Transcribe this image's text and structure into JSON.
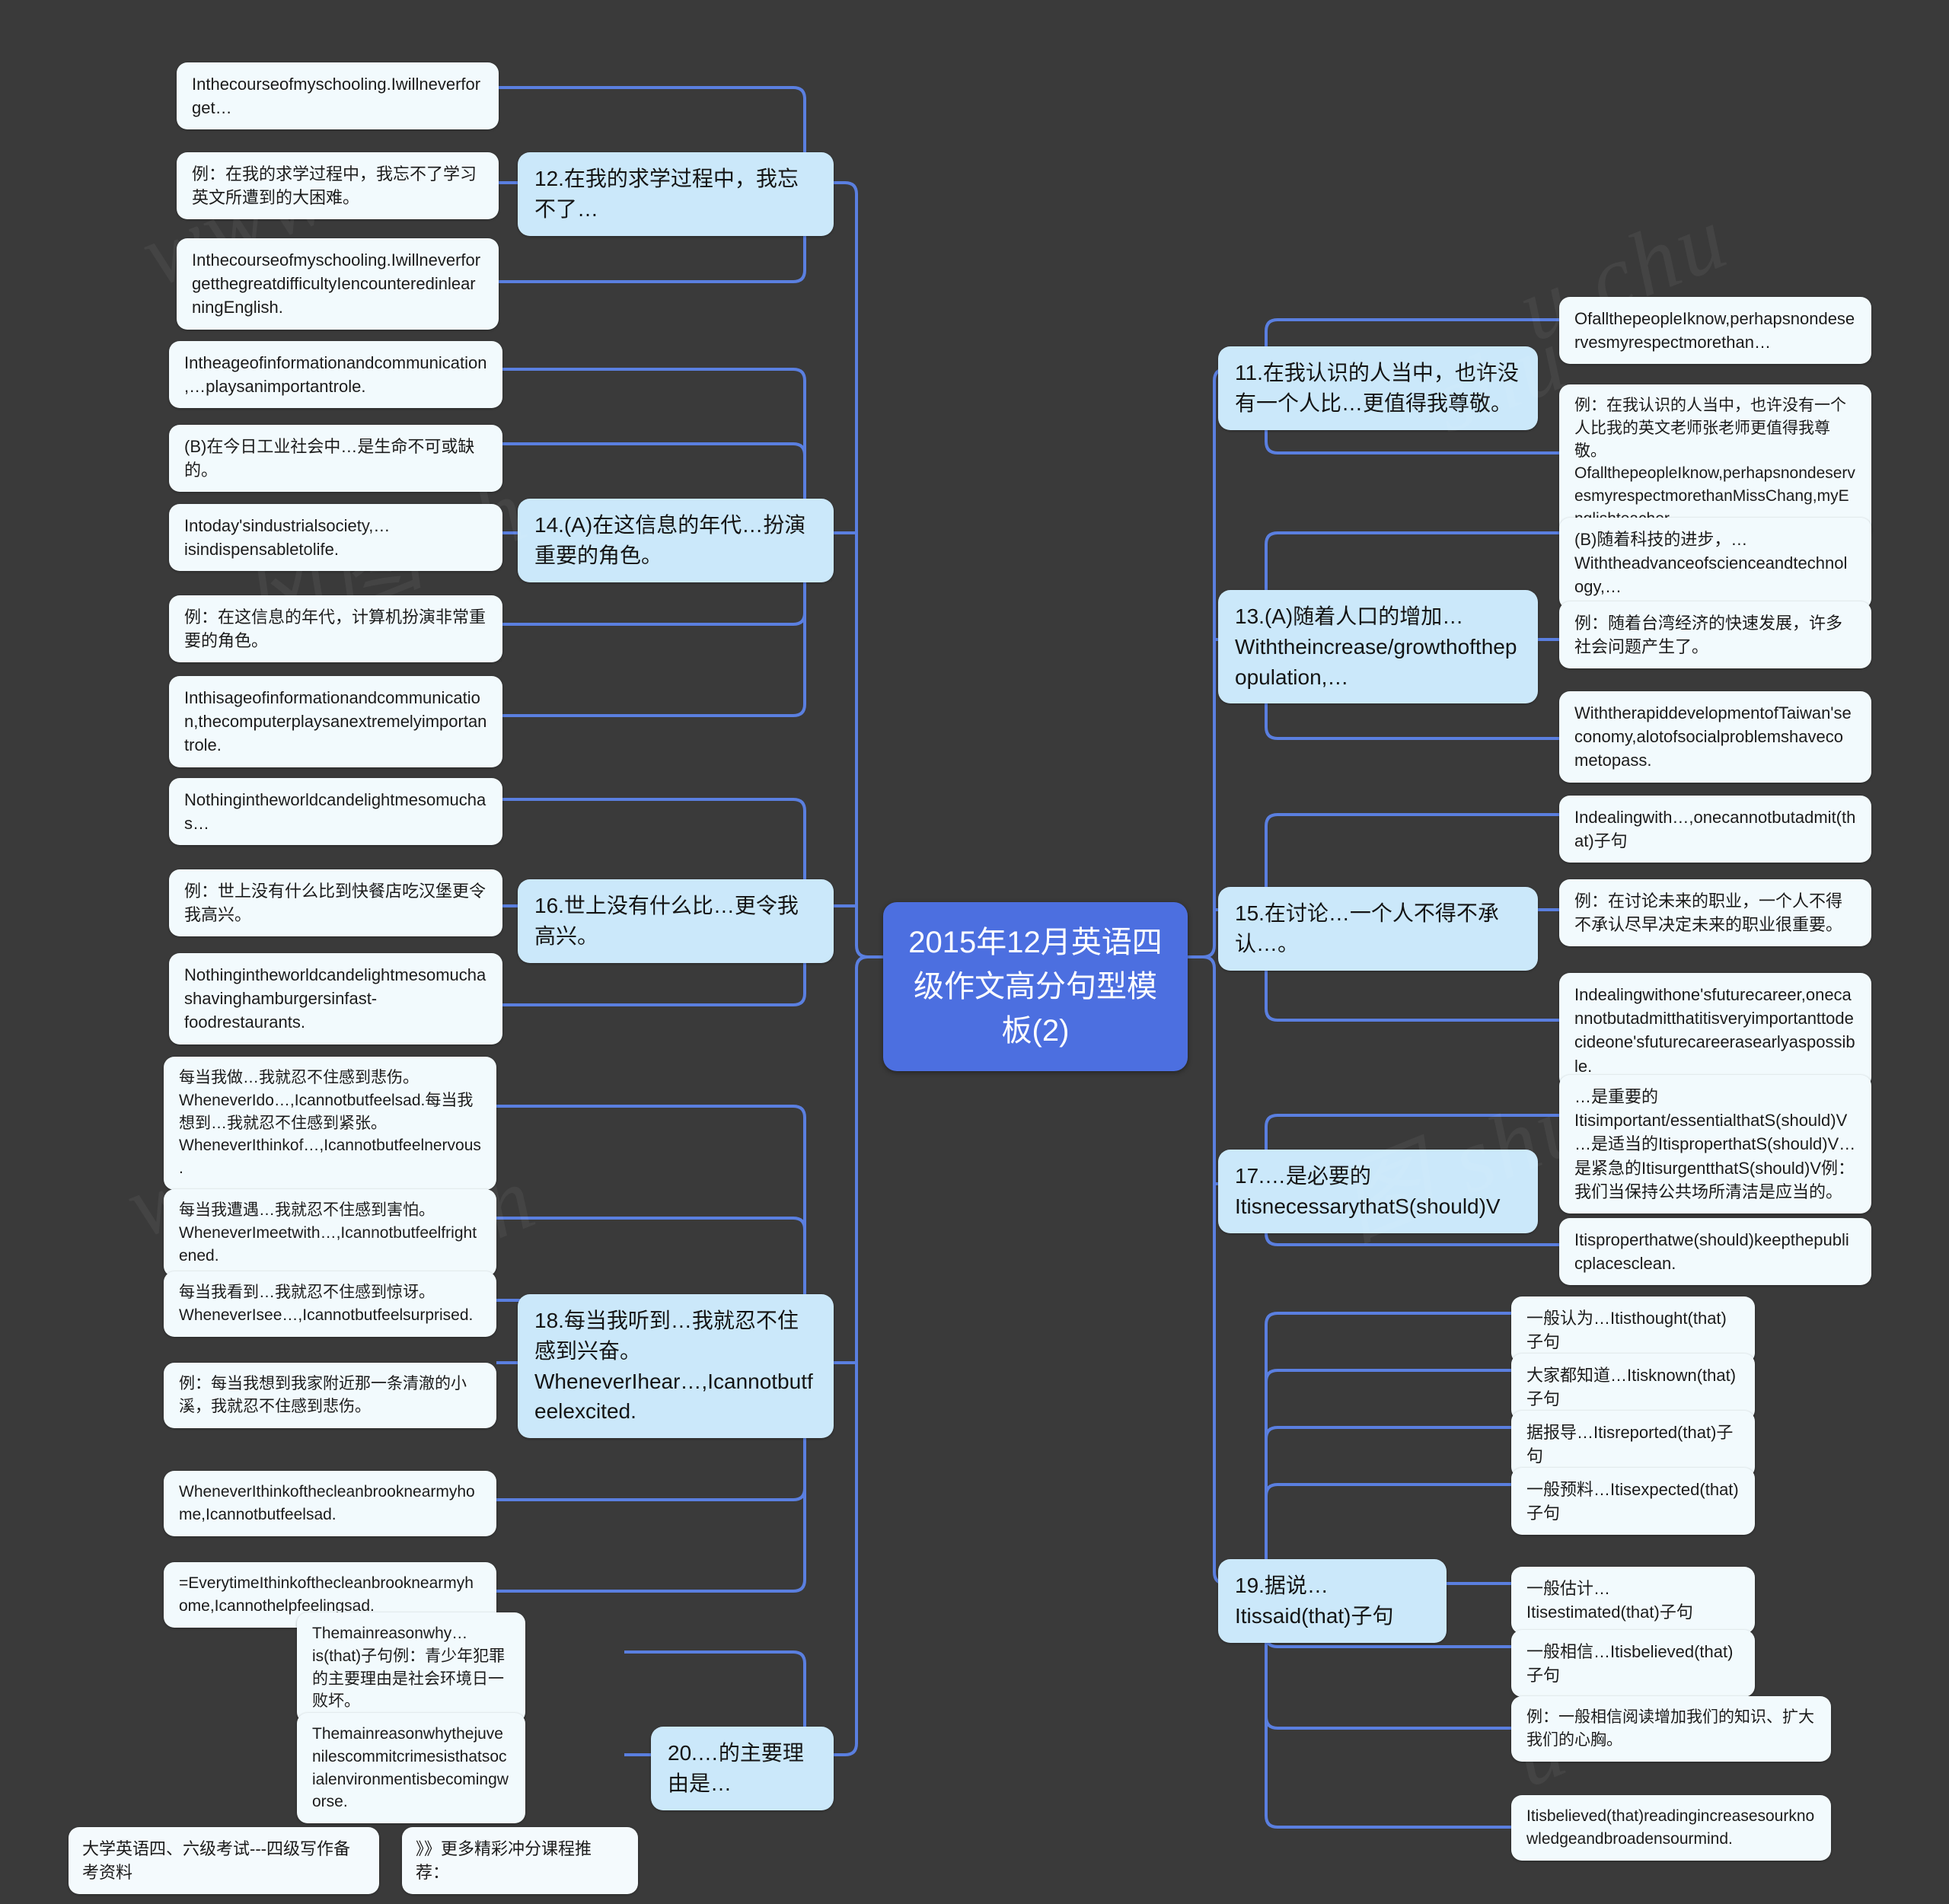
{
  "root": {
    "title": "2015年12月英语四级作文高分句型模板(2)"
  },
  "watermarks": [
    "www.shu...",
    "shu hu",
    "图 shu...",
    "www.s...",
    "风图 sh",
    "chu",
    "A"
  ],
  "colors": {
    "background": "#3a3a3a",
    "root_fill": "#4c6fe0",
    "branch_fill": "#cbe8fa",
    "leaf_fill": "#f2fafd",
    "link_stroke": "#5a7fe0"
  },
  "left_branches": [
    {
      "id": "b12",
      "label": "12.在我的求学过程中，我忘不了…",
      "children": [
        "Inthecourseofmyschooling.Iwillneverforget…",
        "例：在我的求学过程中，我忘不了学习英文所遭到的大困难。",
        "Inthecourseofmyschooling.IwillneverforgetthegreatdifficultyIencounteredinlearningEnglish."
      ]
    },
    {
      "id": "b14",
      "label": "14.(A)在这信息的年代…扮演重要的角色。",
      "children": [
        "Intheageofinformationandcommunication,…playsanimportantrole.",
        "(B)在今日工业社会中…是生命不可或缺的。",
        "Intoday'sindustrialsociety,…isindispensabletolife.",
        "例：在这信息的年代，计算机扮演非常重要的角色。",
        "Inthisageofinformationandcommunication,thecomputerplaysanextremelyimportantrole."
      ]
    },
    {
      "id": "b16",
      "label": "16.世上没有什么比…更令我高兴。",
      "children": [
        "Nothingintheworldcandelightmesomuchas…",
        "例：世上没有什么比到快餐店吃汉堡更令我高兴。",
        "Nothingintheworldcandelightmesomuchashavinghamburgersinfast-foodrestaurants."
      ]
    },
    {
      "id": "b18",
      "label": "18.每当我听到…我就忍不住感到兴奋。WheneverIhear…,Icannotbutfeelexcited.",
      "children": [
        "每当我做…我就忍不住感到悲伤。WheneverIdo…,Icannotbutfeelsad.每当我想到…我就忍不住感到紧张。WheneverIthinkof…,Icannotbutfeelnervous.",
        "每当我遭遇…我就忍不住感到害怕。WheneverImeetwith…,Icannotbutfeelfrightened.",
        "每当我看到…我就忍不住感到惊讶。WheneverIsee…,Icannotbutfeelsurprised.",
        "例：每当我想到我家附近那一条清澈的小溪，我就忍不住感到悲伤。",
        "WheneverIthinkofthecleanbrooknearmyhome,Icannotbutfeelsad.",
        "=EverytimeIthinkofthecleanbrooknearmyhome,Icannothelpfeelingsad."
      ]
    },
    {
      "id": "b20",
      "label": "20.…的主要理由是…",
      "children": [
        "Themainreasonwhy…is(that)子句例：青少年犯罪的主要理由是社会环境日一败坏。",
        "Themainreasonwhythejuvenilescommitcrimesisthatsocialenvironmentisbecomingworse."
      ]
    }
  ],
  "right_branches": [
    {
      "id": "b11",
      "label": "11.在我认识的人当中，也许没有一个人比…更值得我尊敬。",
      "children": [
        "OfallthepeopleIknow,perhapsnondeservesmyrespectmorethan…",
        "例：在我认识的人当中，也许没有一个人比我的英文老师张老师更值得我尊敬。OfallthepeopleIknow,perhapsnondeservesmyrespectmorethanMissChang,myEnglishteacher."
      ]
    },
    {
      "id": "b13",
      "label": "13.(A)随着人口的增加…Withtheincrease/growthofthepopulation,…",
      "children": [
        "(B)随着科技的进步，…Withtheadvanceofscienceandtechnology,…",
        "例：随着台湾经济的快速发展，许多社会问题产生了。",
        "WiththerapiddevelopmentofTaiwan'seconomy,alotofsocialproblemshavecometopass."
      ]
    },
    {
      "id": "b15",
      "label": "15.在讨论…一个人不得不承认…。",
      "children": [
        "Indealingwith…,onecannotbutadmit(that)子句",
        "例：在讨论未来的职业，一个人不得不承认尽早决定未来的职业很重要。",
        "Indealingwithone'sfuturecareer,onecannotbutadmitthatitisveryimportanttodecideone'sfuturecareerasearlyaspossible."
      ]
    },
    {
      "id": "b17",
      "label": "17.…是必要的ItisnecessarythatS(should)V",
      "children": [
        "…是重要的Itisimportant/essentialthatS(should)V…是适当的ItisproperthatS(should)V…是紧急的ItisurgentthatS(should)V例：我们当保持公共场所清洁是应当的。",
        "Itisproperthatwe(should)keepthepublicplacesclean."
      ]
    },
    {
      "id": "b19",
      "label": "19.据说…Itissaid(that)子句",
      "children": [
        "一般认为…Itisthought(that)子句",
        "大家都知道…Itisknown(that)子句",
        "据报导…Itisreported(that)子句",
        "一般预料…Itisexpected(that)子句",
        "一般估计…Itisestimated(that)子句",
        "一般相信…Itisbelieved(that)子句",
        "例：一般相信阅读增加我们的知识、扩大我们的心胸。",
        "Itisbelieved(that)readingincreasesourknowledgeandbroadensourmind."
      ]
    }
  ],
  "footer": {
    "left_label": "大学英语四、六级考试---四级写作备考资料",
    "right_label": "》》更多精彩冲分课程推荐："
  }
}
